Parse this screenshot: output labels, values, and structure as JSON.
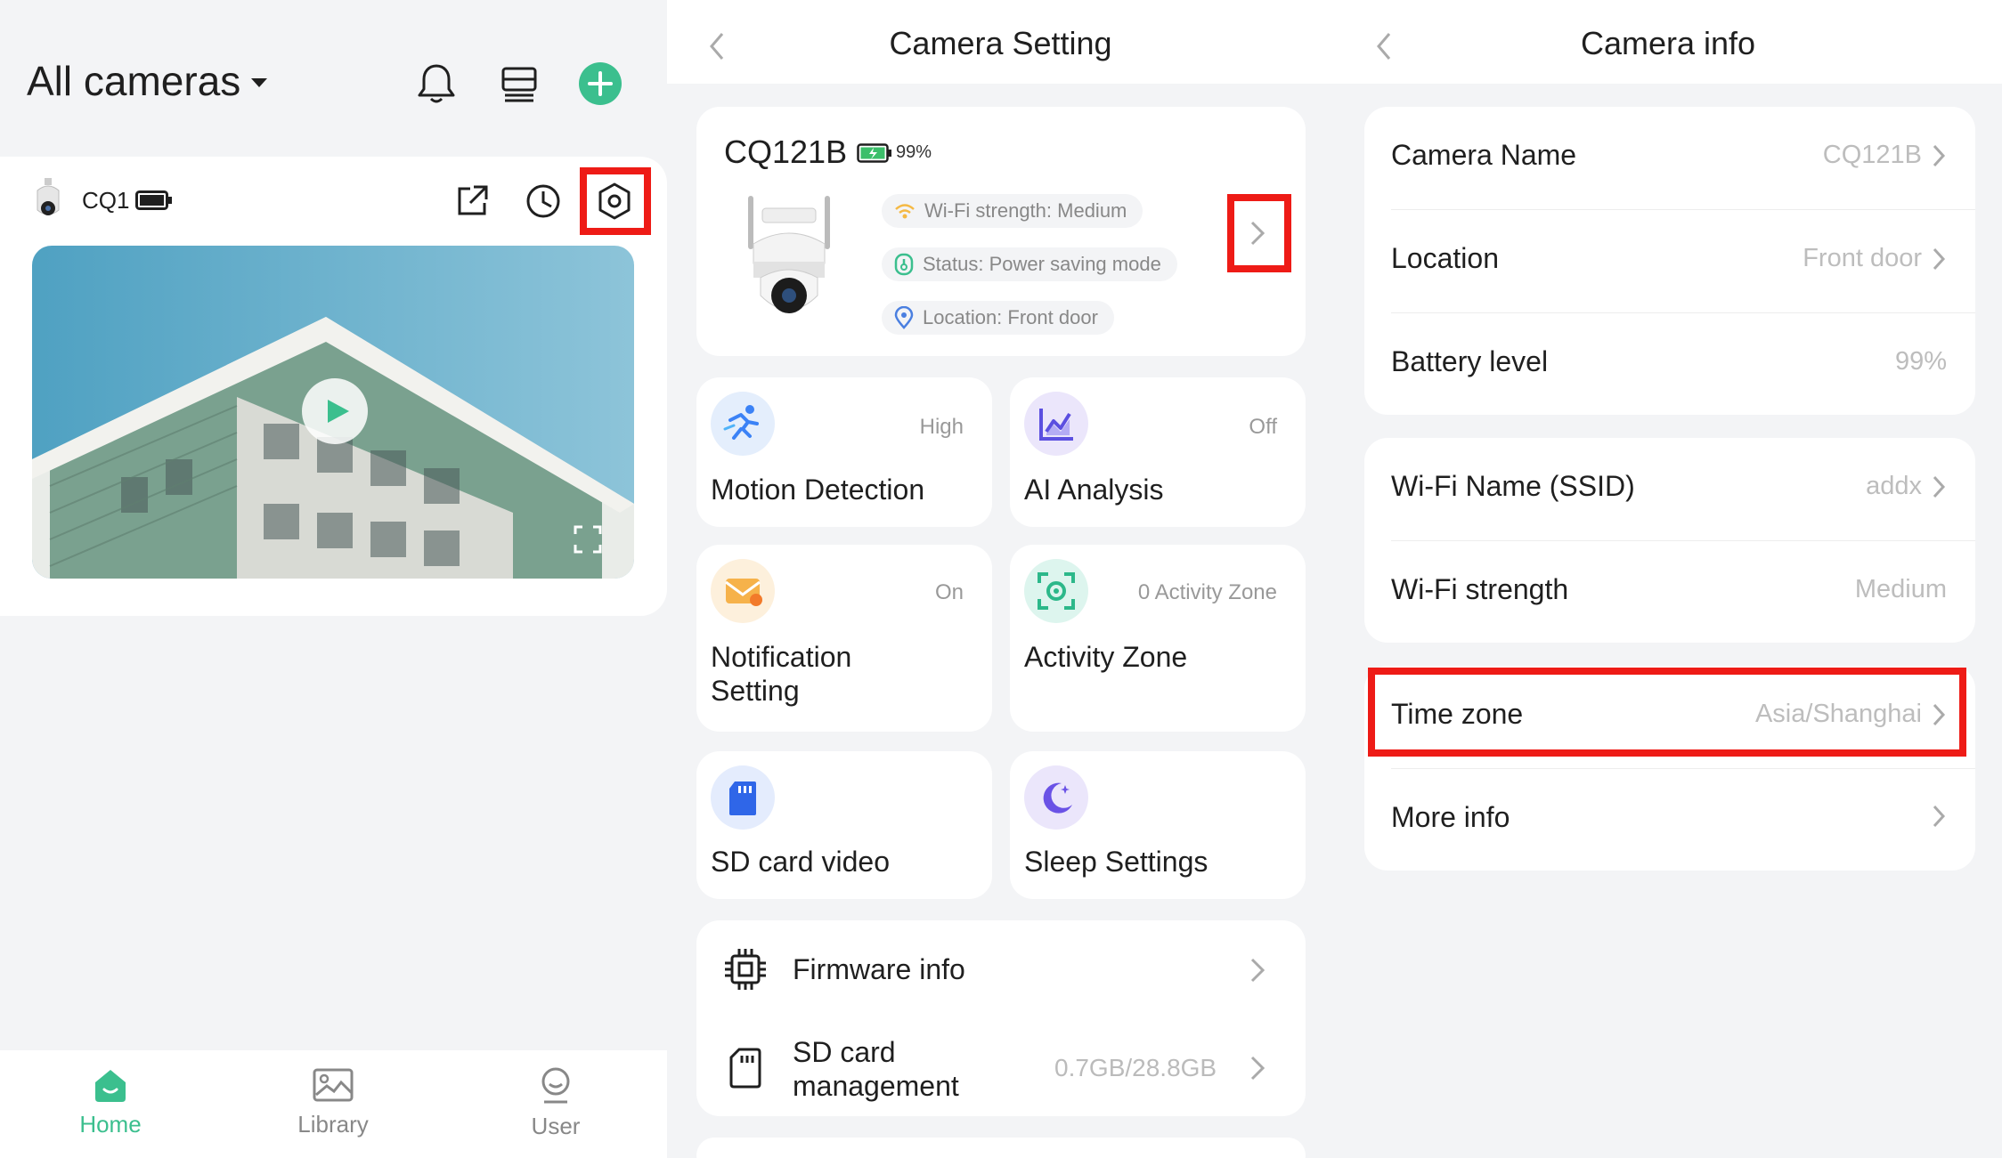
{
  "home": {
    "title": "All cameras",
    "camera": {
      "name": "CQ1"
    },
    "tabs": [
      {
        "label": "Home",
        "icon": "home-icon",
        "active": true
      },
      {
        "label": "Library",
        "icon": "gallery-icon",
        "active": false
      },
      {
        "label": "User",
        "icon": "user-icon",
        "active": false
      }
    ]
  },
  "camera_setting": {
    "title": "Camera Setting",
    "device_name": "CQ121B",
    "battery": "99%",
    "pills": {
      "wifi": "Wi-Fi strength: Medium",
      "status": "Status: Power saving mode",
      "location": "Location: Front door"
    },
    "tiles": {
      "motion": {
        "label": "Motion Detection",
        "value": "High"
      },
      "ai": {
        "label": "AI Analysis",
        "value": "Off"
      },
      "notification": {
        "label_line1": "Notification",
        "label_line2": "Setting",
        "value": "On"
      },
      "activity": {
        "label": "Activity Zone",
        "value": "0 Activity Zone"
      },
      "sd_video": {
        "label": "SD card video"
      },
      "sleep": {
        "label": "Sleep Settings"
      }
    },
    "rows": {
      "firmware": {
        "label": "Firmware info"
      },
      "sd_management": {
        "label_line1": "SD card",
        "label_line2": "management",
        "value": "0.7GB/28.8GB"
      }
    }
  },
  "camera_info": {
    "title": "Camera info",
    "rows": [
      {
        "label": "Camera Name",
        "value": "CQ121B"
      },
      {
        "label": "Location",
        "value": "Front door"
      },
      {
        "label": "Battery level",
        "value": "99%"
      },
      {
        "label": "Wi-Fi Name (SSID)",
        "value": "addx"
      },
      {
        "label": "Wi-Fi strength",
        "value": "Medium"
      },
      {
        "label": "Time zone",
        "value": "Asia/Shanghai"
      },
      {
        "label": "More info",
        "value": ""
      }
    ]
  },
  "colors": {
    "accent_green": "#3bbf8e",
    "highlight_red": "#ee1b16",
    "background": "#f3f4f6"
  }
}
